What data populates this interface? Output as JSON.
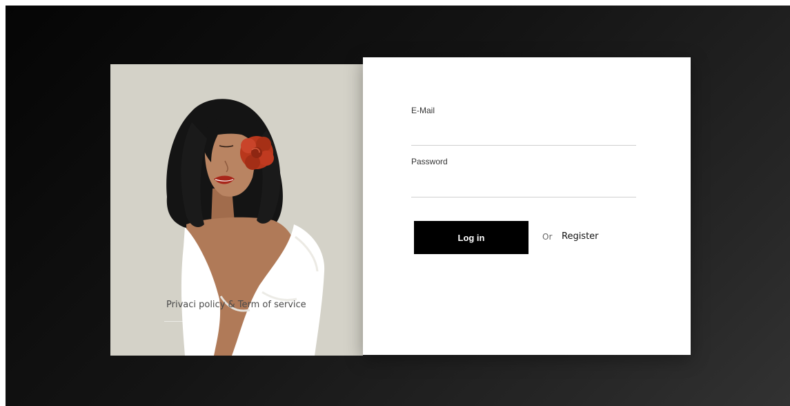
{
  "illustration": {
    "icon": "woman-with-flower-illustration",
    "colors": {
      "panel_background": "#d4d2c8",
      "hair": "#141414",
      "skin": "#b07a58",
      "flower": "#b8371c",
      "lips": "#a8261a",
      "shirt": "#ffffff"
    },
    "privacy_link_label": "Privaci policy & Term of service"
  },
  "login_form": {
    "email_label": "E-Mail",
    "email_value": "",
    "password_label": "Password",
    "password_value": "",
    "login_button_label": "Log in",
    "or_text": "Or",
    "register_link_label": "Register"
  },
  "colors": {
    "background_dark": "#050505",
    "background_light": "#323232",
    "button": "#000000",
    "form_background": "#ffffff"
  }
}
